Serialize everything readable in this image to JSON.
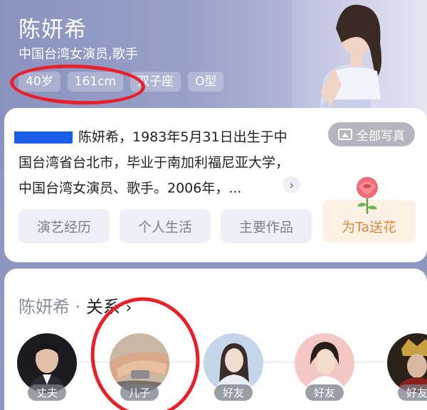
{
  "header": {
    "name": "陈妍希",
    "subtitle": "中国台湾女演员,歌手",
    "tags": [
      "40岁",
      "161cm",
      "双子座",
      "O型"
    ],
    "all_photos": "全部写真"
  },
  "bio": {
    "text": "陈妍希，1983年5月31日出生于中国台湾省台北市，毕业于南加利福尼亚大学，中国台湾女演员、歌手。2006年，...",
    "buttons": [
      "演艺经历",
      "个人生活",
      "主要作品"
    ],
    "flower_button": "为Ta送花"
  },
  "relations": {
    "title_name": "陈妍希 · ",
    "title_suffix": "关系",
    "arrow": "›",
    "items": [
      {
        "label": "丈夫"
      },
      {
        "label": "儿子"
      },
      {
        "label": "好友"
      },
      {
        "label": "好友"
      },
      {
        "label": "好友"
      }
    ]
  },
  "colors": {
    "annotation_red": "#e8202a",
    "header_bg": "#98a1c8",
    "flower_text": "#d98a3b"
  }
}
